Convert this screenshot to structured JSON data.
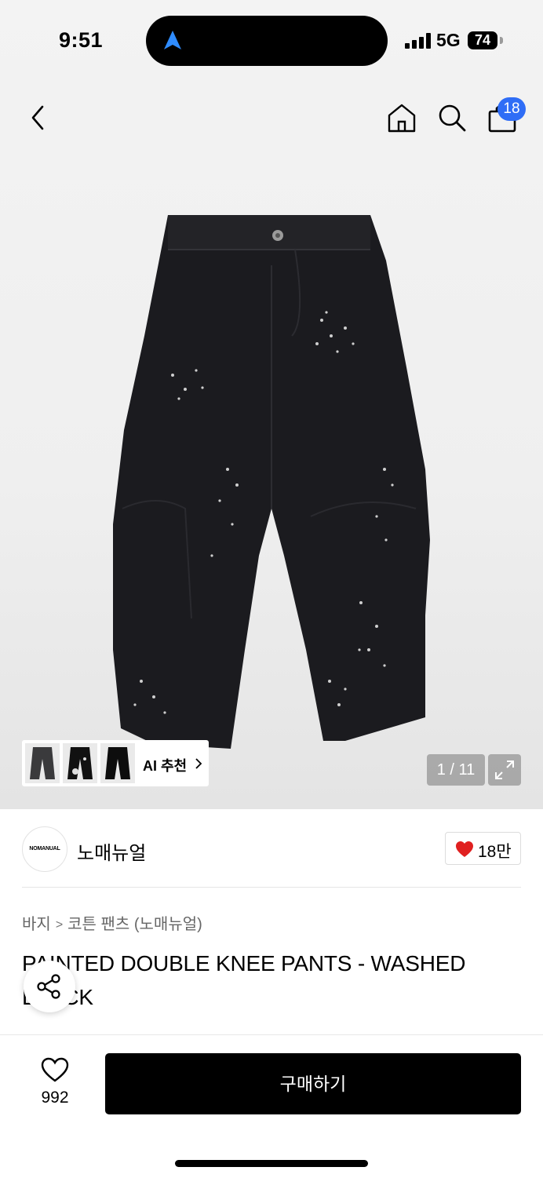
{
  "status_bar": {
    "time": "9:51",
    "network": "5G",
    "battery": "74"
  },
  "header": {
    "cart_count": "18",
    "icons": [
      "back-icon",
      "home-icon",
      "search-icon",
      "shopping-bag-icon"
    ]
  },
  "gallery": {
    "ai_recommend_label": "AI 추천",
    "counter": "1 / 11"
  },
  "brand": {
    "logo_text": "NOMANUAL",
    "name": "노매뉴얼",
    "like_count": "18만"
  },
  "breadcrumb": {
    "items": [
      "바지",
      "코튼 팬츠 (노매뉴얼)"
    ]
  },
  "product": {
    "title": "PAINTED DOUBLE KNEE PANTS - WASHED BLACK"
  },
  "bottom_bar": {
    "wish_count": "992",
    "buy_label": "구매하기"
  },
  "colors": {
    "badge": "#2f6df6",
    "heart": "#e02020",
    "buy_button": "#000000"
  }
}
